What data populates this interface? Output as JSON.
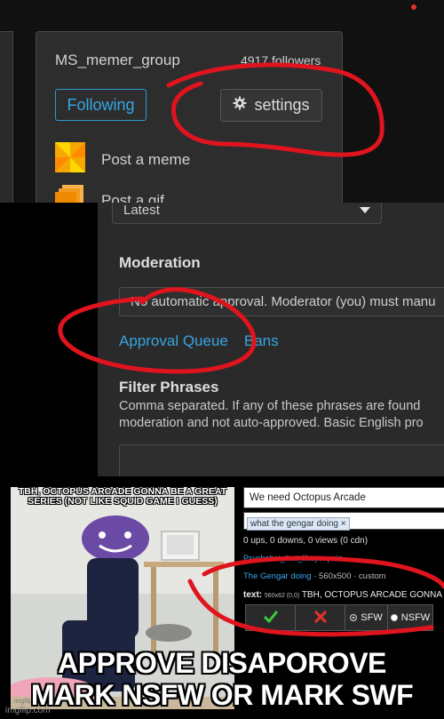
{
  "panel1": {
    "group_name": "MS_memer_group",
    "followers": "4917 followers",
    "following_label": "Following",
    "settings_label": "settings",
    "menu_items": [
      {
        "label": "Post a meme",
        "icon": "pinwheel-icon"
      },
      {
        "label": "Post a gif",
        "icon": "gif-stack-icon"
      }
    ]
  },
  "panel2": {
    "dropdown_value": "Latest",
    "moderation_label": "Moderation",
    "moderation_value": "No automatic approval. Moderator (you) must manu",
    "approval_queue_link": "Approval Queue",
    "bans_link": "Bans",
    "filter_label": "Filter Phrases",
    "filter_help_line1": "Comma separated. If any of these phrases are found",
    "filter_help_line2": "moderation and not auto-approved. Basic English pro"
  },
  "panel3": {
    "image_caption": "TBH, OCTOPUS ARCADE GONNA BE A GREAT SERIES (NOT LIKE SQUID GAME I GUESS)",
    "image_watermark": "imgflip.com",
    "title_value": "We need Octopus Arcade",
    "tag": "what the gengar doing ×",
    "stats": "0 ups, 0 downs, 0 views (0 cdn)",
    "username": "Psychoboi_that_likeyoupain",
    "template_link": "The Gengar doing",
    "meta_rest": " · 560x500 · custom",
    "text_label": "text:",
    "text_dims": "560x62 (0,0)",
    "text_value": "TBH, OCTOPUS ARCADE GONNA BE A G",
    "sfw_label": "SFW",
    "nsfw_label": "NSFW"
  },
  "caption_line1": "APPROVE DISAPOROVE",
  "caption_line2": "MARK NSFW OR MARK SWF",
  "watermark": "imgflip.com",
  "colors": {
    "link_blue": "#37a4e0",
    "scribble_red": "#e0141e",
    "approve_green": "#3cc83c",
    "disapprove_red": "#e5302e"
  }
}
